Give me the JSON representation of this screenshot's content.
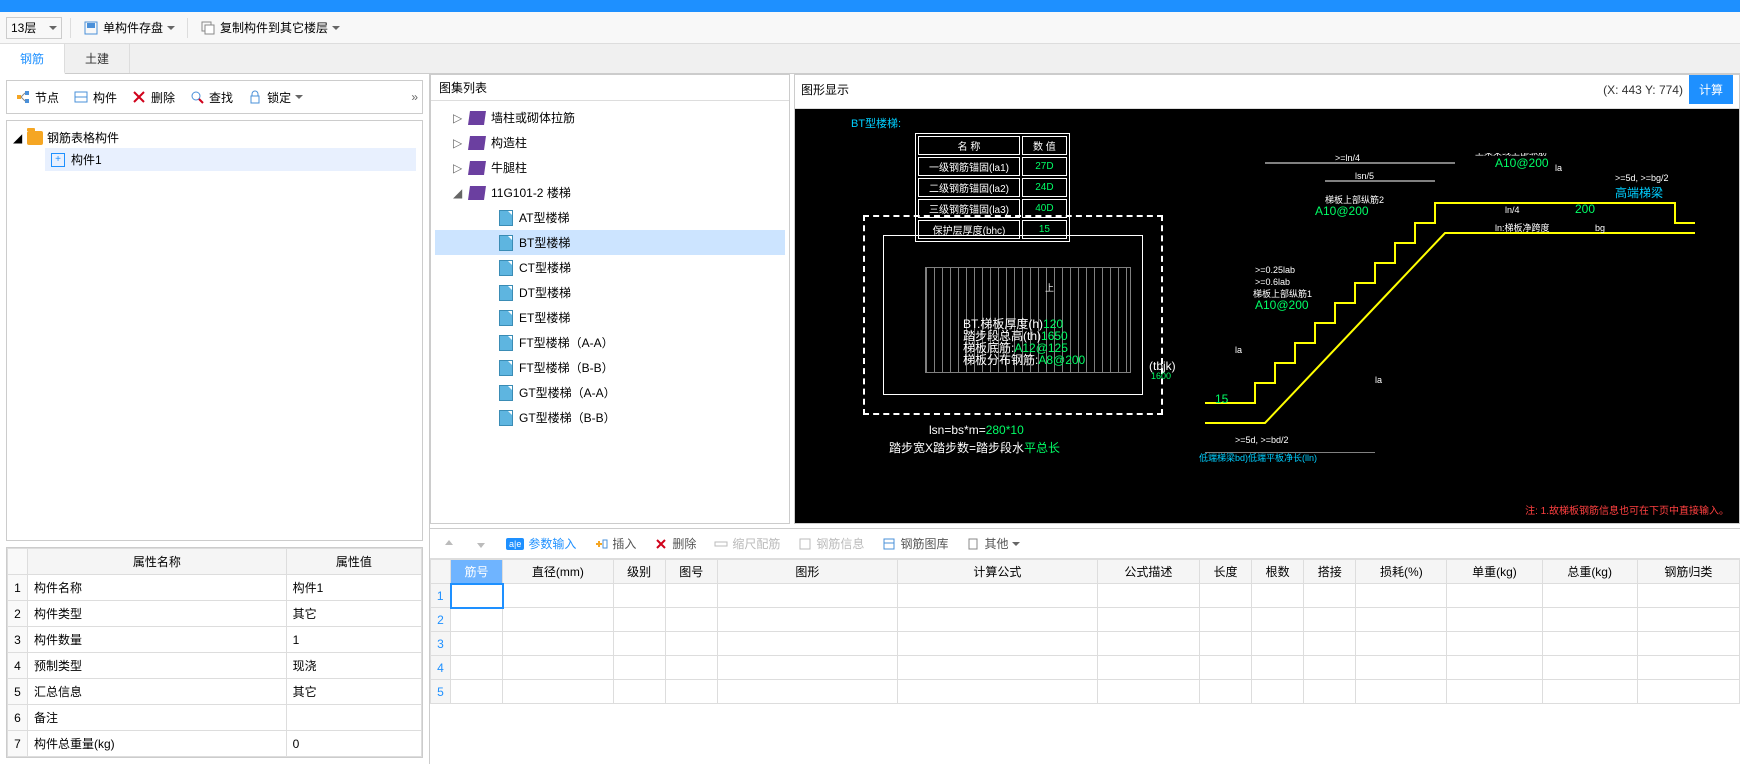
{
  "toolbar": {
    "floor": "13层",
    "save_component": "单构件存盘",
    "copy_component": "复制构件到其它楼层"
  },
  "tabs": {
    "rebar": "钢筋",
    "civil": "土建"
  },
  "left": {
    "btn_node": "节点",
    "btn_component": "构件",
    "btn_delete": "删除",
    "btn_find": "查找",
    "btn_lock": "锁定",
    "tree_root": "钢筋表格构件",
    "tree_item1": "构件1"
  },
  "props": {
    "header_name": "属性名称",
    "header_value": "属性值",
    "rows": [
      {
        "n": "1",
        "name": "构件名称",
        "value": "构件1"
      },
      {
        "n": "2",
        "name": "构件类型",
        "value": "其它"
      },
      {
        "n": "3",
        "name": "构件数量",
        "value": "1"
      },
      {
        "n": "4",
        "name": "预制类型",
        "value": "现浇"
      },
      {
        "n": "5",
        "name": "汇总信息",
        "value": "其它"
      },
      {
        "n": "6",
        "name": "备注",
        "value": ""
      },
      {
        "n": "7",
        "name": "构件总重量(kg)",
        "value": "0"
      }
    ]
  },
  "gallery": {
    "title": "图集列表",
    "items": [
      {
        "label": "墙柱或砌体拉筋",
        "type": "book",
        "expand": "▷",
        "indent": 0
      },
      {
        "label": "构造柱",
        "type": "book",
        "expand": "▷",
        "indent": 0
      },
      {
        "label": "牛腿柱",
        "type": "book",
        "expand": "▷",
        "indent": 0
      },
      {
        "label": "11G101-2 楼梯",
        "type": "book",
        "expand": "◢",
        "indent": 0
      },
      {
        "label": "AT型楼梯",
        "type": "sheet",
        "indent": 1
      },
      {
        "label": "BT型楼梯",
        "type": "sheet",
        "indent": 1,
        "selected": true
      },
      {
        "label": "CT型楼梯",
        "type": "sheet",
        "indent": 1
      },
      {
        "label": "DT型楼梯",
        "type": "sheet",
        "indent": 1
      },
      {
        "label": "ET型楼梯",
        "type": "sheet",
        "indent": 1
      },
      {
        "label": "FT型楼梯（A-A）",
        "type": "sheet",
        "indent": 1
      },
      {
        "label": "FT型楼梯（B-B）",
        "type": "sheet",
        "indent": 1
      },
      {
        "label": "GT型楼梯（A-A）",
        "type": "sheet",
        "indent": 1
      },
      {
        "label": "GT型楼梯（B-B）",
        "type": "sheet",
        "indent": 1
      }
    ]
  },
  "diagram": {
    "title": "图形显示",
    "coord": "(X: 443 Y: 774)",
    "calc_btn": "计算",
    "d_title": "BT型楼梯:",
    "table_hdr_name": "名 称",
    "table_hdr_val": "数 值",
    "table_rows": [
      {
        "n": "一级钢筋锚固(la1)",
        "v": "27D"
      },
      {
        "n": "二级钢筋锚固(la2)",
        "v": "24D"
      },
      {
        "n": "三级钢筋锚固(la3)",
        "v": "40D"
      },
      {
        "n": "保护层厚度(bhc)",
        "v": "15"
      }
    ],
    "plan_h_label": "BT.梯板厚度(h)",
    "plan_h_val": "120",
    "plan_th_label": "踏步段总高(th)",
    "plan_th_val": "1650",
    "plan_bar_label": "梯板底筋:",
    "plan_bar_val": "A12@125",
    "plan_dist_label": "梯板分布钢筋:",
    "plan_dist_val": "A8@200",
    "lsn_label": "lsn=bs*m=",
    "lsn_val": "280*10",
    "step_label1": "踏步宽X踏步数=踏步段水",
    "step_val": "平总长",
    "tbjk_label": "(tbjk)",
    "tbjk_val": "1600",
    "sec_top_bar": "梯板上部纵筋1",
    "sec_top_bar2": "梯板上部纵筋2",
    "sec_top_val": "A10@200",
    "upper_beam": "上梁架线上部纵筋",
    "upper_val": "A10@200",
    "high_beam": "高端梯梁",
    "ln4": "ln/4",
    "ln5": "lsn/5",
    "la": "la",
    "lab_cond": ">=0.25lab",
    ">lab": ">=0.6lab",
    "ln_span": "ln:梯板净跨度",
    "bg": "bg",
    "n200": "200",
    "low_annot": "低端梯梁bd)低端平板净长(lln)",
    "bd2": ">=5d, >=bd/2",
    "bg2": ">=5d, >=bg/2",
    "note": "注: 1.故梯板钢筋信息也可在下页中直接输入。"
  },
  "bottom": {
    "btn_param": "参数输入",
    "btn_insert": "插入",
    "btn_delete": "删除",
    "btn_scale": "缩尺配筋",
    "btn_info": "钢筋信息",
    "btn_lib": "钢筋图库",
    "btn_other": "其他",
    "cols": [
      "筋号",
      "直径(mm)",
      "级别",
      "图号",
      "图形",
      "计算公式",
      "公式描述",
      "长度",
      "根数",
      "搭接",
      "损耗(%)",
      "单重(kg)",
      "总重(kg)",
      "钢筋归类"
    ],
    "row_nums": [
      "1",
      "2",
      "3",
      "4",
      "5"
    ]
  }
}
